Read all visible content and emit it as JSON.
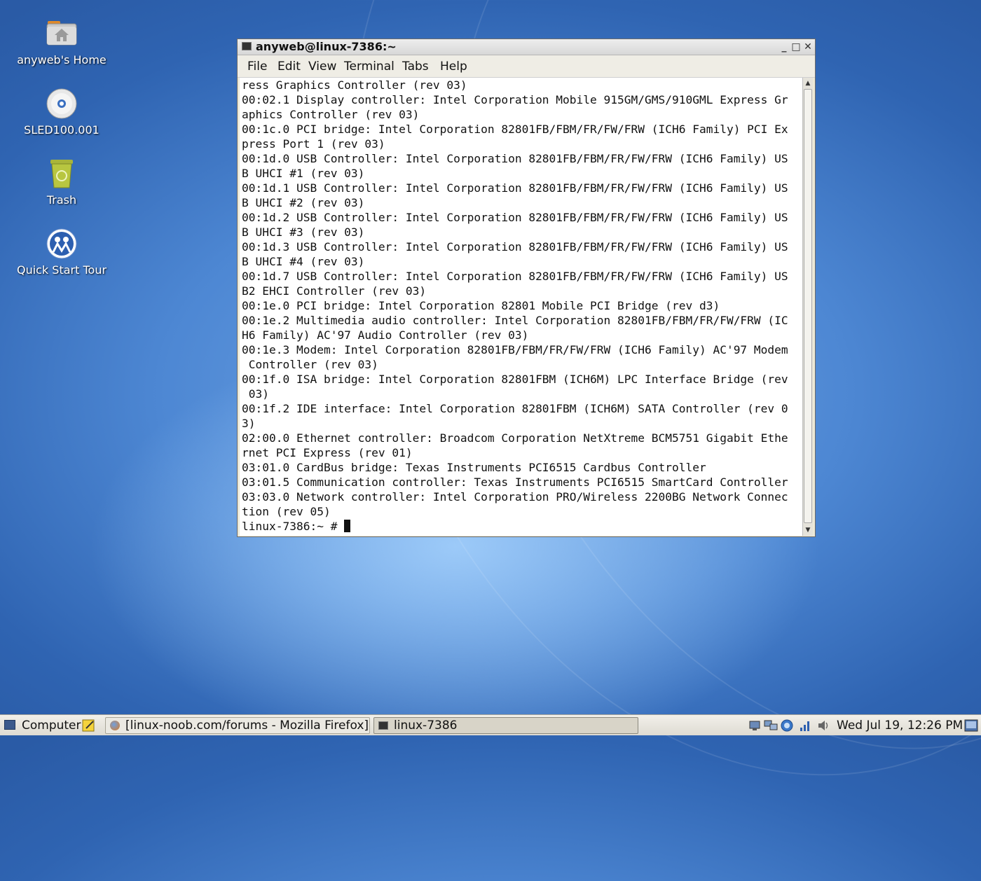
{
  "desktop": {
    "icons": [
      {
        "label": "anyweb's Home"
      },
      {
        "label": "SLED100.001"
      },
      {
        "label": "Trash"
      },
      {
        "label": "Quick Start Tour"
      }
    ]
  },
  "terminal_window": {
    "title": "anyweb@linux-7386:~",
    "menu": [
      "File",
      "Edit",
      "View",
      "Terminal",
      "Tabs",
      "Help"
    ],
    "output_lines": [
      "ress Graphics Controller (rev 03)",
      "00:02.1 Display controller: Intel Corporation Mobile 915GM/GMS/910GML Express Gr",
      "aphics Controller (rev 03)",
      "00:1c.0 PCI bridge: Intel Corporation 82801FB/FBM/FR/FW/FRW (ICH6 Family) PCI Ex",
      "press Port 1 (rev 03)",
      "00:1d.0 USB Controller: Intel Corporation 82801FB/FBM/FR/FW/FRW (ICH6 Family) US",
      "B UHCI #1 (rev 03)",
      "00:1d.1 USB Controller: Intel Corporation 82801FB/FBM/FR/FW/FRW (ICH6 Family) US",
      "B UHCI #2 (rev 03)",
      "00:1d.2 USB Controller: Intel Corporation 82801FB/FBM/FR/FW/FRW (ICH6 Family) US",
      "B UHCI #3 (rev 03)",
      "00:1d.3 USB Controller: Intel Corporation 82801FB/FBM/FR/FW/FRW (ICH6 Family) US",
      "B UHCI #4 (rev 03)",
      "00:1d.7 USB Controller: Intel Corporation 82801FB/FBM/FR/FW/FRW (ICH6 Family) US",
      "B2 EHCI Controller (rev 03)",
      "00:1e.0 PCI bridge: Intel Corporation 82801 Mobile PCI Bridge (rev d3)",
      "00:1e.2 Multimedia audio controller: Intel Corporation 82801FB/FBM/FR/FW/FRW (IC",
      "H6 Family) AC'97 Audio Controller (rev 03)",
      "00:1e.3 Modem: Intel Corporation 82801FB/FBM/FR/FW/FRW (ICH6 Family) AC'97 Modem",
      " Controller (rev 03)",
      "00:1f.0 ISA bridge: Intel Corporation 82801FBM (ICH6M) LPC Interface Bridge (rev",
      " 03)",
      "00:1f.2 IDE interface: Intel Corporation 82801FBM (ICH6M) SATA Controller (rev 0",
      "3)",
      "02:00.0 Ethernet controller: Broadcom Corporation NetXtreme BCM5751 Gigabit Ethe",
      "rnet PCI Express (rev 01)",
      "03:01.0 CardBus bridge: Texas Instruments PCI6515 Cardbus Controller",
      "03:01.5 Communication controller: Texas Instruments PCI6515 SmartCard Controller",
      "03:03.0 Network controller: Intel Corporation PRO/Wireless 2200BG Network Connec",
      "tion (rev 05)"
    ],
    "prompt": "linux-7386:~ # "
  },
  "panel": {
    "computer_label": "Computer",
    "tasks": [
      {
        "label": "[linux-noob.com/forums - Mozilla Firefox]"
      },
      {
        "label": "linux-7386"
      }
    ],
    "clock": "Wed Jul 19, 12:26 PM"
  },
  "icons": {
    "home": "home-folder-icon",
    "cd": "cd-disc-icon",
    "trash": "trash-icon",
    "tour": "quick-start-tour-icon"
  }
}
